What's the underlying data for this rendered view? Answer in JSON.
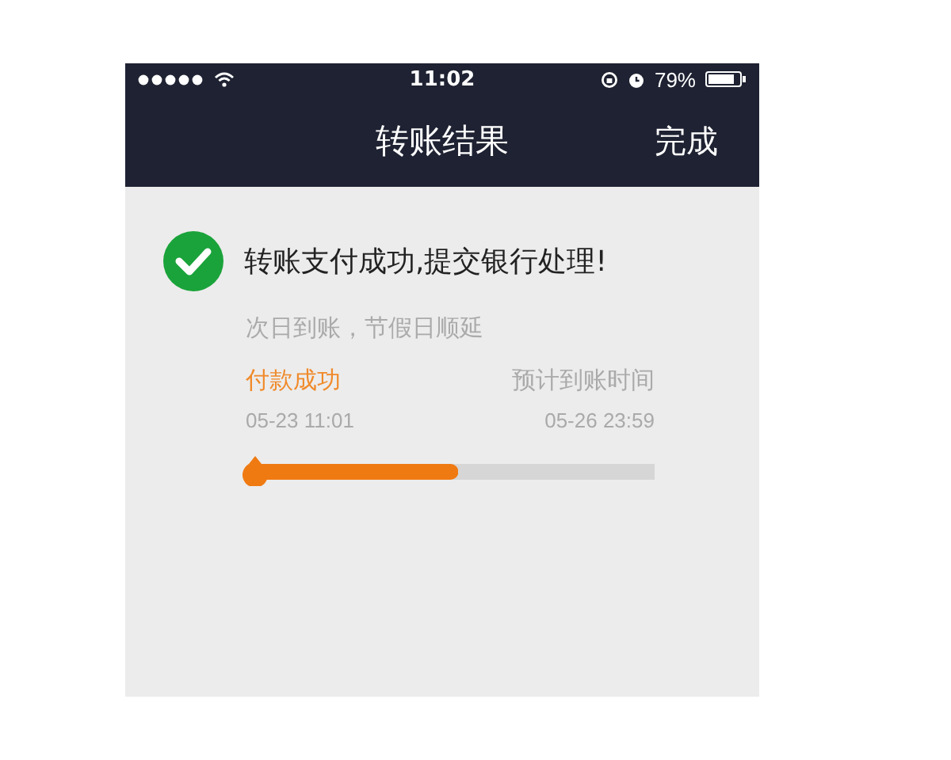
{
  "status_bar": {
    "time": "11:02",
    "battery": "79%"
  },
  "nav_bar": {
    "title": "转账结果",
    "action": "完成"
  },
  "result": {
    "message": "转账支付成功,提交银行处理!",
    "note": "次日到账，节假日顺延"
  },
  "steps": [
    {
      "label": "付款成功",
      "time": "05-23 11:01",
      "completed": true
    },
    {
      "label": "预计到账时间",
      "time": "05-26 23:59",
      "completed": false
    }
  ],
  "progress": {
    "level": 0.52
  }
}
